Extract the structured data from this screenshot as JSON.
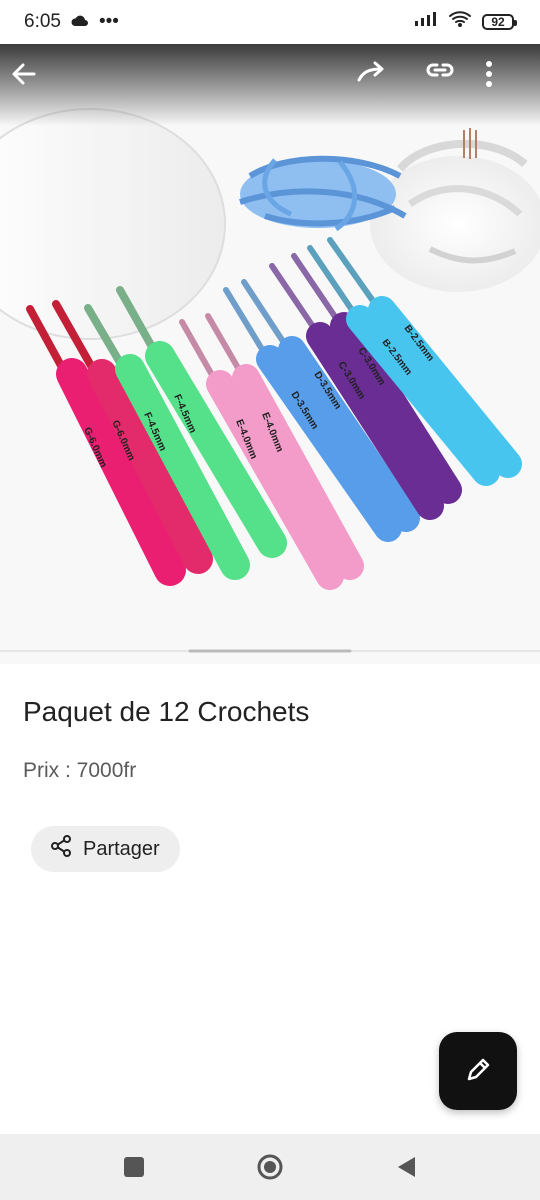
{
  "status_bar": {
    "time": "6:05",
    "battery": "92"
  },
  "product": {
    "title": "Paquet de 12 Crochets",
    "price": "Prix : 7000fr",
    "share_label": "Partager",
    "hook_labels": [
      "G-6.0mm",
      "G-6.0mm",
      "F-4.5mm",
      "F-4.5mm",
      "E-4.0mm",
      "E-4.0mm",
      "D-3.5mm",
      "D-3.5mm",
      "C-3.0mm",
      "C-3.0mm",
      "B-2.5mm",
      "B-2.5mm"
    ]
  },
  "icons": {
    "back": "arrow-left-icon",
    "forward": "forward-icon",
    "link": "link-icon",
    "more": "more-vertical-icon",
    "share": "share-icon",
    "edit": "pencil-icon",
    "nav_recent": "square-icon",
    "nav_home": "circle-icon",
    "nav_back": "triangle-icon"
  },
  "colors": {
    "hot_pink": "#ea1f71",
    "pink": "#f39bc9",
    "green": "#55e08a",
    "blue": "#579de9",
    "purple": "#6a2d93",
    "cyan": "#48c5ef",
    "yarn_blue": "#8fbef1"
  }
}
